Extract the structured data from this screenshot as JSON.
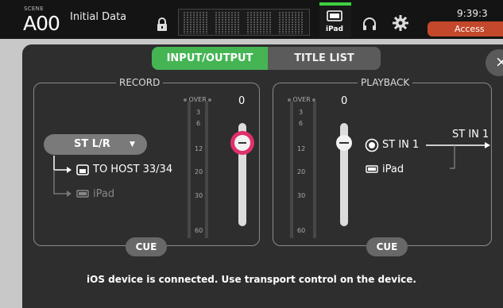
{
  "topbar": {
    "scene_label": "SCENE",
    "scene_number": "A00",
    "scene_name": "Initial Data",
    "ipad_label": "iPad",
    "clock": "9:39:3",
    "access_label": "Access",
    "status_ok_color": "#3dd13d",
    "access_color": "#c4482c"
  },
  "tabs": {
    "input_output": "INPUT/OUTPUT",
    "title_list": "TITLE LIST",
    "active_color": "#45b554"
  },
  "close_label": "×",
  "record": {
    "title": "RECORD",
    "source": "ST L/R",
    "over_label": "OVER",
    "level": "0",
    "scale": [
      "3",
      "6",
      "12",
      "20",
      "30",
      "60"
    ],
    "dest_host": "TO HOST 33/34",
    "dest_ipad": "iPad",
    "cue_label": "CUE",
    "fader_color": "#e0306e"
  },
  "playback": {
    "title": "PLAYBACK",
    "over_label": "OVER",
    "level": "0",
    "scale": [
      "3",
      "6",
      "12",
      "20",
      "30",
      "60"
    ],
    "option_stin": "ST IN 1",
    "option_ipad": "iPad",
    "output": "ST IN 1",
    "cue_label": "CUE"
  },
  "status_message": "iOS device is connected. Use transport control on the device."
}
